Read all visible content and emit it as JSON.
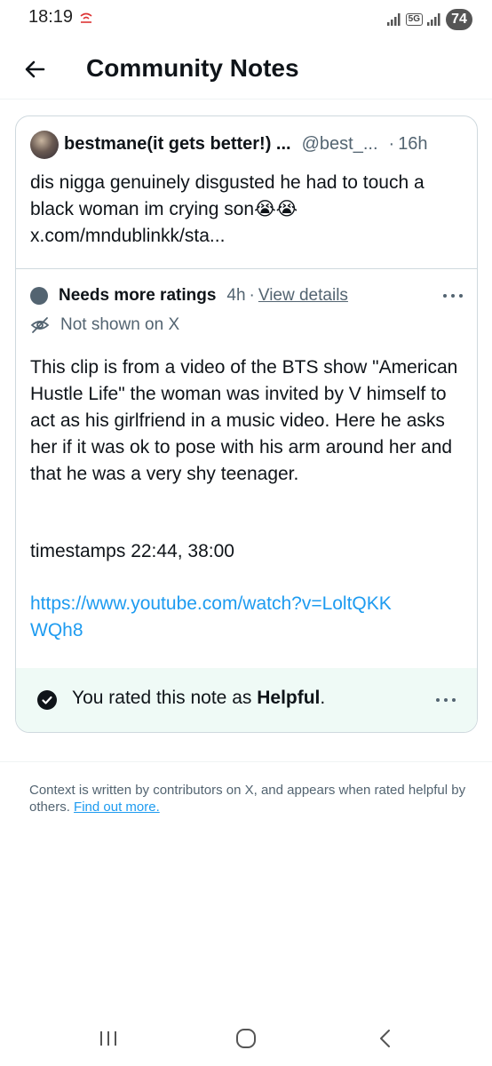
{
  "status_bar": {
    "time": "18:19",
    "network": "5G",
    "battery": "74"
  },
  "header": {
    "title": "Community Notes"
  },
  "tweet": {
    "display_name": "bestmane(it gets better!) ...",
    "handle": "@best_...",
    "separator": "·",
    "time": "16h",
    "text": "dis nigga genuinely disgusted he had to touch a black woman im crying son😭😭 x.com/mndublinkk/sta..."
  },
  "note": {
    "status": "Needs more ratings",
    "age": "4h",
    "separator": "·",
    "view_details": "View details",
    "visibility": "Not shown on X",
    "body": "This clip is from a video of the BTS show \"American Hustle Life\" the woman was invited by V himself to act as his girlfriend in a music video. Here he asks her if it was ok to pose with his arm around her and that he was a very shy teenager.",
    "timestamps": "timestamps 22:44, 38:00",
    "link": "https://www.youtube.com/watch?v=LoltQKKWQh8"
  },
  "rating": {
    "prefix": "You rated this note as ",
    "value": "Helpful",
    "suffix": "."
  },
  "footer": {
    "text": "Context is written by contributors on X, and appears when rated helpful by others. ",
    "link": "Find out more."
  },
  "icons": {
    "back": "arrow-left-icon",
    "more": "more-horizontal-icon",
    "eye_off": "eye-off-icon",
    "check": "check-circle-icon"
  },
  "colors": {
    "link": "#1d9bf0",
    "secondary_text": "#536471",
    "rating_background": "#effaf6",
    "status_dot": "#536471"
  }
}
